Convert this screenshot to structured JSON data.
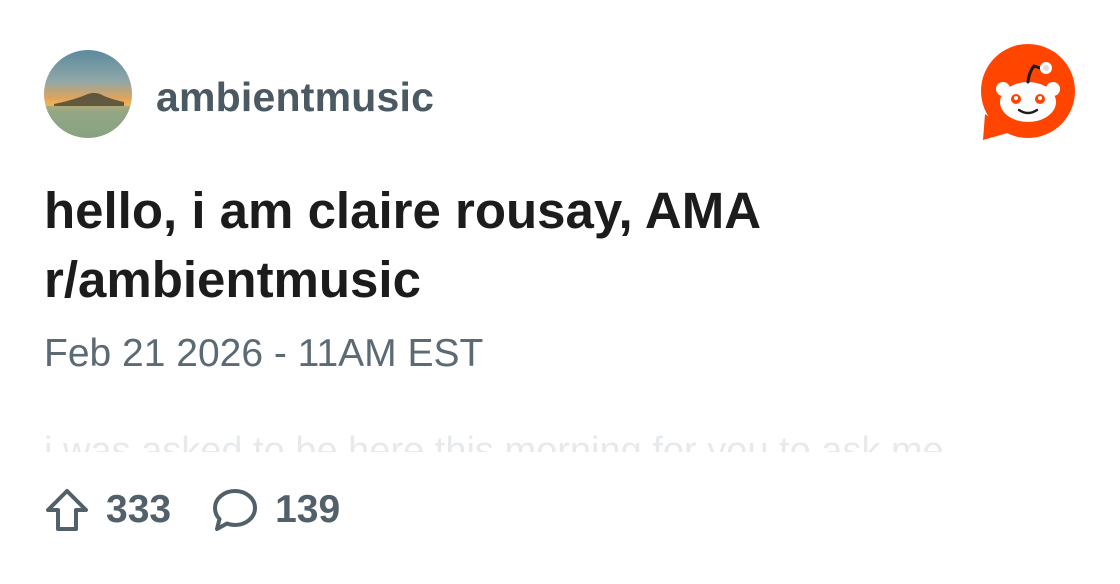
{
  "post": {
    "subreddit_name": "ambientmusic",
    "title_line1": "hello, i am claire rousay, AMA",
    "title_line2": "r/ambientmusic",
    "date": "Feb 21 2026 - 11AM EST",
    "body_preview": "i was asked to be here this morning for you to ask me"
  },
  "stats": {
    "upvotes": "333",
    "comments": "139"
  },
  "icons": {
    "upvote": "upvote-arrow-icon",
    "comment": "comment-bubble-icon",
    "logo": "reddit-logo-icon"
  },
  "colors": {
    "brand": "#ff4500",
    "title": "#1c1c1c",
    "meta": "#5c6a73"
  }
}
